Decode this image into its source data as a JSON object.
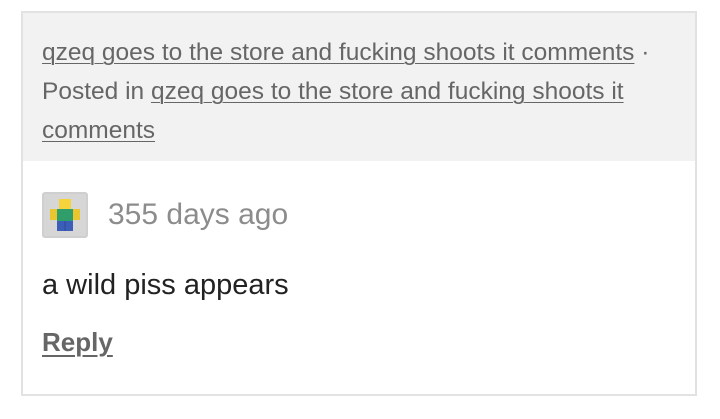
{
  "post": {
    "title_link": "qzeq goes to the store and fucking shoots it comments",
    "separator": " · ",
    "posted_in_label": "Posted in ",
    "posted_in_link": "qzeq goes to the store and fucking shoots it comments"
  },
  "comment": {
    "avatar_icon": "roblox-noob-avatar-icon",
    "timestamp": "355 days ago",
    "body": "a wild piss appears",
    "reply_label": "Reply"
  },
  "colors": {
    "header_bg": "#f2f2f2",
    "link_text": "#666666",
    "timestamp_text": "#8c8c8c",
    "body_text": "#222222",
    "border": "#e2e2e2"
  }
}
